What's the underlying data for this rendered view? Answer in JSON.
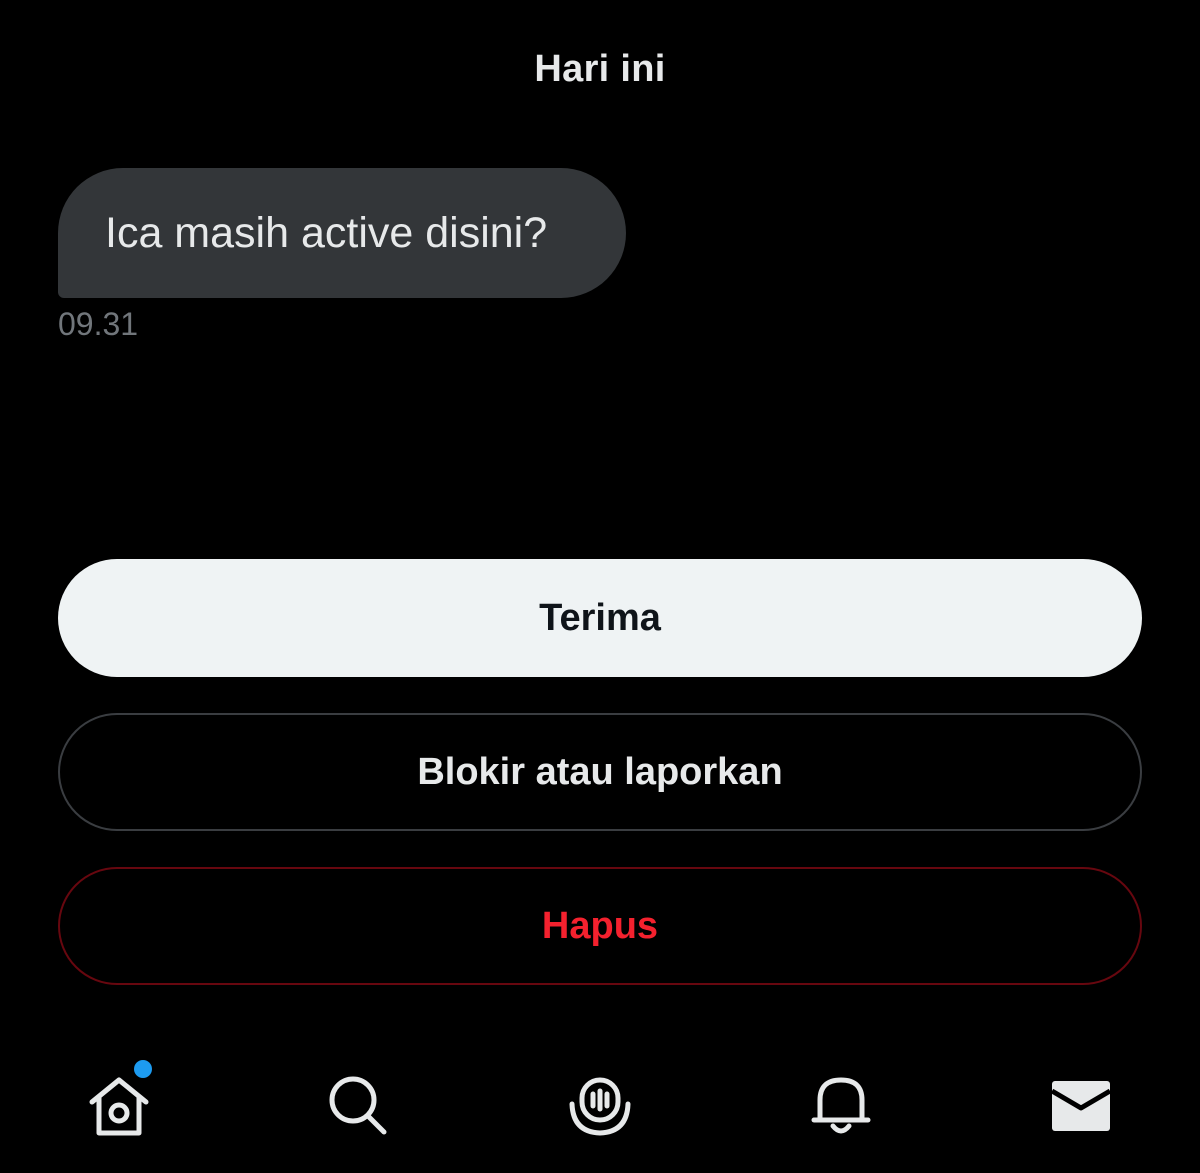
{
  "conversation": {
    "date_header": "Hari ini",
    "messages": [
      {
        "text": "Ica masih active disini?",
        "time": "09.31"
      }
    ]
  },
  "actions": {
    "accept_label": "Terima",
    "block_label": "Blokir atau laporkan",
    "delete_label": "Hapus"
  },
  "bottom_nav": {
    "items": [
      {
        "icon": "home-icon",
        "has_notification_dot": true
      },
      {
        "icon": "search-icon"
      },
      {
        "icon": "spaces-icon"
      },
      {
        "icon": "bell-icon"
      },
      {
        "icon": "mail-icon",
        "active": true
      }
    ]
  },
  "colors": {
    "background": "#000000",
    "bubble": "#333639",
    "delete_text": "#f4212e",
    "notification_dot": "#1d9bf0"
  }
}
